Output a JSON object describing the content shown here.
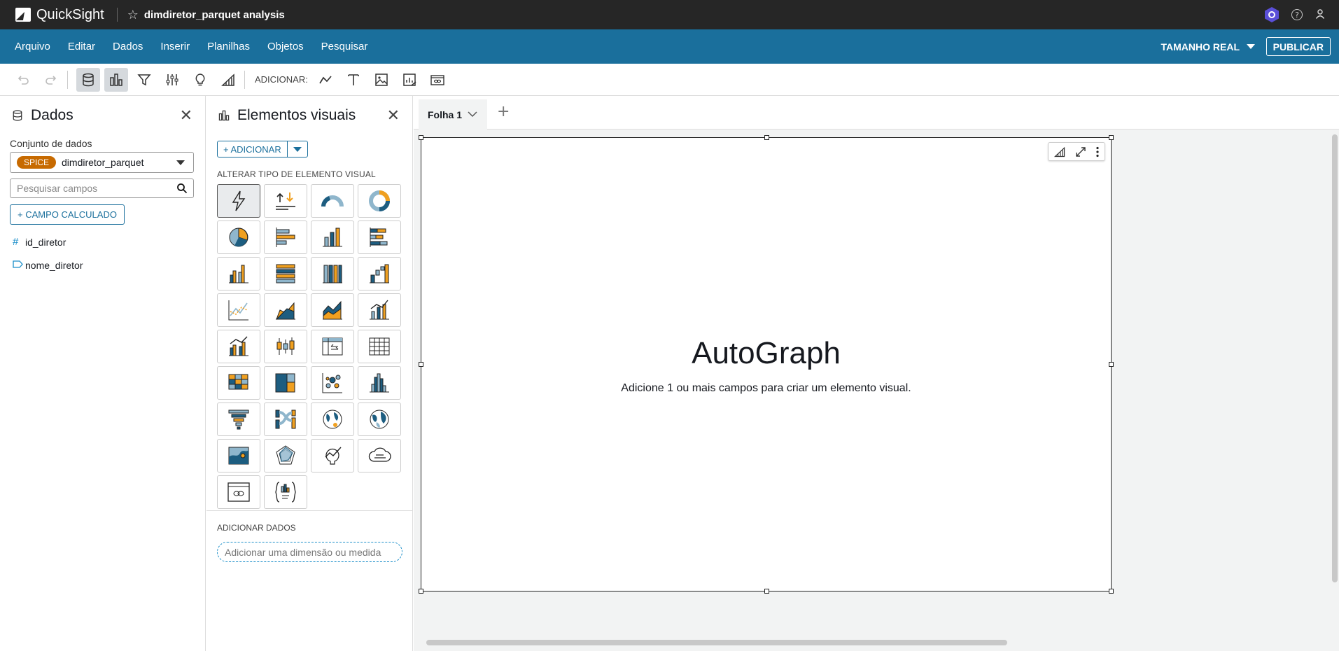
{
  "app": {
    "name": "QuickSight",
    "analysis_title": "dimdiretor_parquet analysis"
  },
  "menu": {
    "items": [
      "Arquivo",
      "Editar",
      "Dados",
      "Inserir",
      "Planilhas",
      "Objetos",
      "Pesquisar"
    ],
    "size_label": "TAMANHO REAL",
    "publish_label": "PUBLICAR"
  },
  "toolbar": {
    "add_label": "ADICIONAR:"
  },
  "data_panel": {
    "title": "Dados",
    "dataset_label": "Conjunto de dados",
    "dataset_badge": "SPICE",
    "dataset_name": "dimdiretor_parquet",
    "search_placeholder": "Pesquisar campos",
    "calc_field_label": "+  CAMPO CALCULADO",
    "fields": [
      {
        "icon": "#",
        "name": "id_diretor"
      },
      {
        "icon": "tag",
        "name": "nome_diretor"
      }
    ]
  },
  "visuals_panel": {
    "title": "Elementos visuais",
    "add_label": "+ ADICIONAR",
    "change_type_label": "ALTERAR TIPO DE ELEMENTO VISUAL",
    "add_data_label": "ADICIONAR DADOS",
    "dimension_placeholder": "Adicionar uma dimensão ou medida"
  },
  "canvas": {
    "sheet_tab": "Folha 1",
    "visual_title": "AutoGraph",
    "visual_subtitle": "Adicione 1 ou mais campos para criar um elemento visual."
  },
  "colors": {
    "topbar": "#262626",
    "menubar": "#1a6f9c",
    "accent": "#1a6f9c",
    "spice": "#c76a00",
    "chart_orange": "#f0a020",
    "chart_blue": "#1d5d80"
  }
}
